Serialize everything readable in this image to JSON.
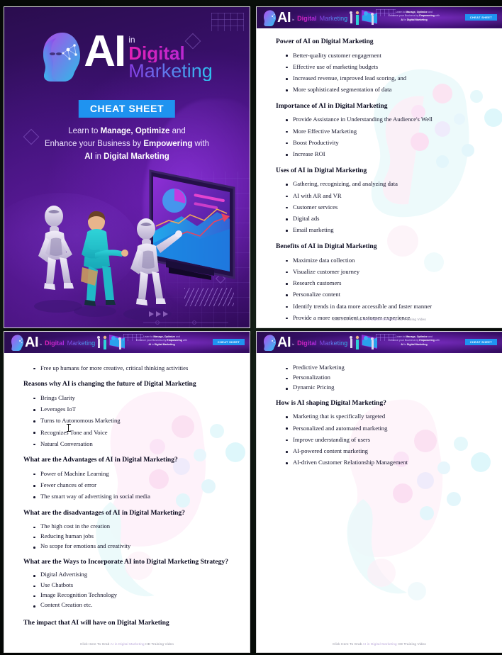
{
  "document": {
    "title": "AI in Digital Marketing Cheat Sheet",
    "accent_blue": "#1f93f0",
    "accent_magenta": "#e220b4",
    "accent_cyan": "#2bc6f0",
    "page_bg": "#ffffff",
    "canvas_bg": "#0d140f"
  },
  "cover": {
    "logo": {
      "ai": "AI",
      "in": "in",
      "digital": "Digital",
      "marketing": "Marketing",
      "head_icon": "ai-head-profile-icon"
    },
    "badge": "CHEAT SHEET",
    "subtitle_line1_prefix": "Learn to ",
    "subtitle_line1_bold": "Manage, Optimize",
    "subtitle_line1_suffix": " and",
    "subtitle_line2_prefix": "Enhance your Business by ",
    "subtitle_line2_bold": "Empowering",
    "subtitle_line2_suffix": " with",
    "subtitle_line3_bold_a": "AI",
    "subtitle_line3_mid": " in ",
    "subtitle_line3_bold_b": "Digital Marketing",
    "illustration": "isometric-robots-and-businessman-at-dashboard-screen"
  },
  "header": {
    "logo": {
      "ai": "AI",
      "in": "in",
      "digital": "Digital",
      "marketing": "Marketing"
    },
    "tagline_line1_prefix": "Learn to ",
    "tagline_line1_bold": "Manage, Optimize",
    "tagline_line1_suffix": " and",
    "tagline_line2_prefix": "Enhance your Business by ",
    "tagline_line2_bold": "Empowering",
    "tagline_line2_suffix": " with",
    "tagline_line3_bold_a": "AI",
    "tagline_line3_mid": " in ",
    "tagline_line3_bold_b": "Digital Marketing",
    "badge": "CHEAT SHEET"
  },
  "footer": {
    "prefix": "Click Here To Grab ",
    "highlight": "AI in Digital Marketing",
    "suffix": "  HD Training Video"
  },
  "pages": {
    "page2": {
      "sections": [
        {
          "heading": "Power of AI on Digital Marketing",
          "items": [
            "Better-quality customer engagement",
            "Effective use of marketing budgets",
            "Increased revenue, improved lead scoring, and",
            "More sophisticated segmentation of data"
          ]
        },
        {
          "heading": "Importance of AI in Digital Marketing",
          "items": [
            "Provide Assistance in Understanding the Audience's Well",
            "More Effective Marketing",
            "Boost Productivity",
            "Increase ROI"
          ]
        },
        {
          "heading": "Uses of AI in Digital Marketing",
          "items": [
            "Gathering, recognizing, and analyzing data",
            "AI with AR and VR",
            "Customer services",
            "Digital ads",
            "Email marketing"
          ]
        },
        {
          "heading": "Benefits of AI in Digital Marketing",
          "items": [
            "Maximize data collection",
            "Visualize customer journey",
            "Research customers",
            "Personalize content",
            "Identify trends in data more accessible and faster manner",
            "Provide a more convenient customer experience"
          ]
        }
      ]
    },
    "page3": {
      "lead_items": [
        "Free up humans for more creative, critical thinking activities"
      ],
      "sections": [
        {
          "heading": "Reasons why AI is changing the future of Digital Marketing",
          "items": [
            "Brings Clarity",
            "Leverages IoT",
            "Turns to Autonomous Marketing",
            "Recognizes Tone and Voice",
            "Natural Conversation"
          ]
        },
        {
          "heading": "What are the Advantages of AI in Digital Marketing?",
          "items": [
            "Power of Machine Learning",
            "Fewer chances of error",
            "The smart way of advertising in social media"
          ]
        },
        {
          "heading": "What are the disadvantages of AI in Digital Marketing?",
          "items": [
            "The high cost in the creation",
            "Reducing human jobs",
            "No scope for emotions and creativity"
          ]
        },
        {
          "heading": "What are the Ways to Incorporate AI into Digital Marketing Strategy?",
          "items": [
            "Digital Advertising",
            "Use Chatbots",
            "Image Recognition Technology",
            "Content Creation etc."
          ]
        },
        {
          "heading": "The impact that AI will have on Digital Marketing",
          "items": []
        }
      ]
    },
    "page4": {
      "lead_items": [
        "Predictive Marketing",
        "Personalization",
        "Dynamic Pricing"
      ],
      "sections": [
        {
          "heading": "How is AI shaping Digital Marketing?",
          "items": [
            "Marketing that is specifically targeted",
            "Personalized and automated marketing",
            "Improve understanding of users",
            "AI-powered content marketing",
            "AI-driven Customer Relationship Management"
          ]
        }
      ]
    }
  }
}
